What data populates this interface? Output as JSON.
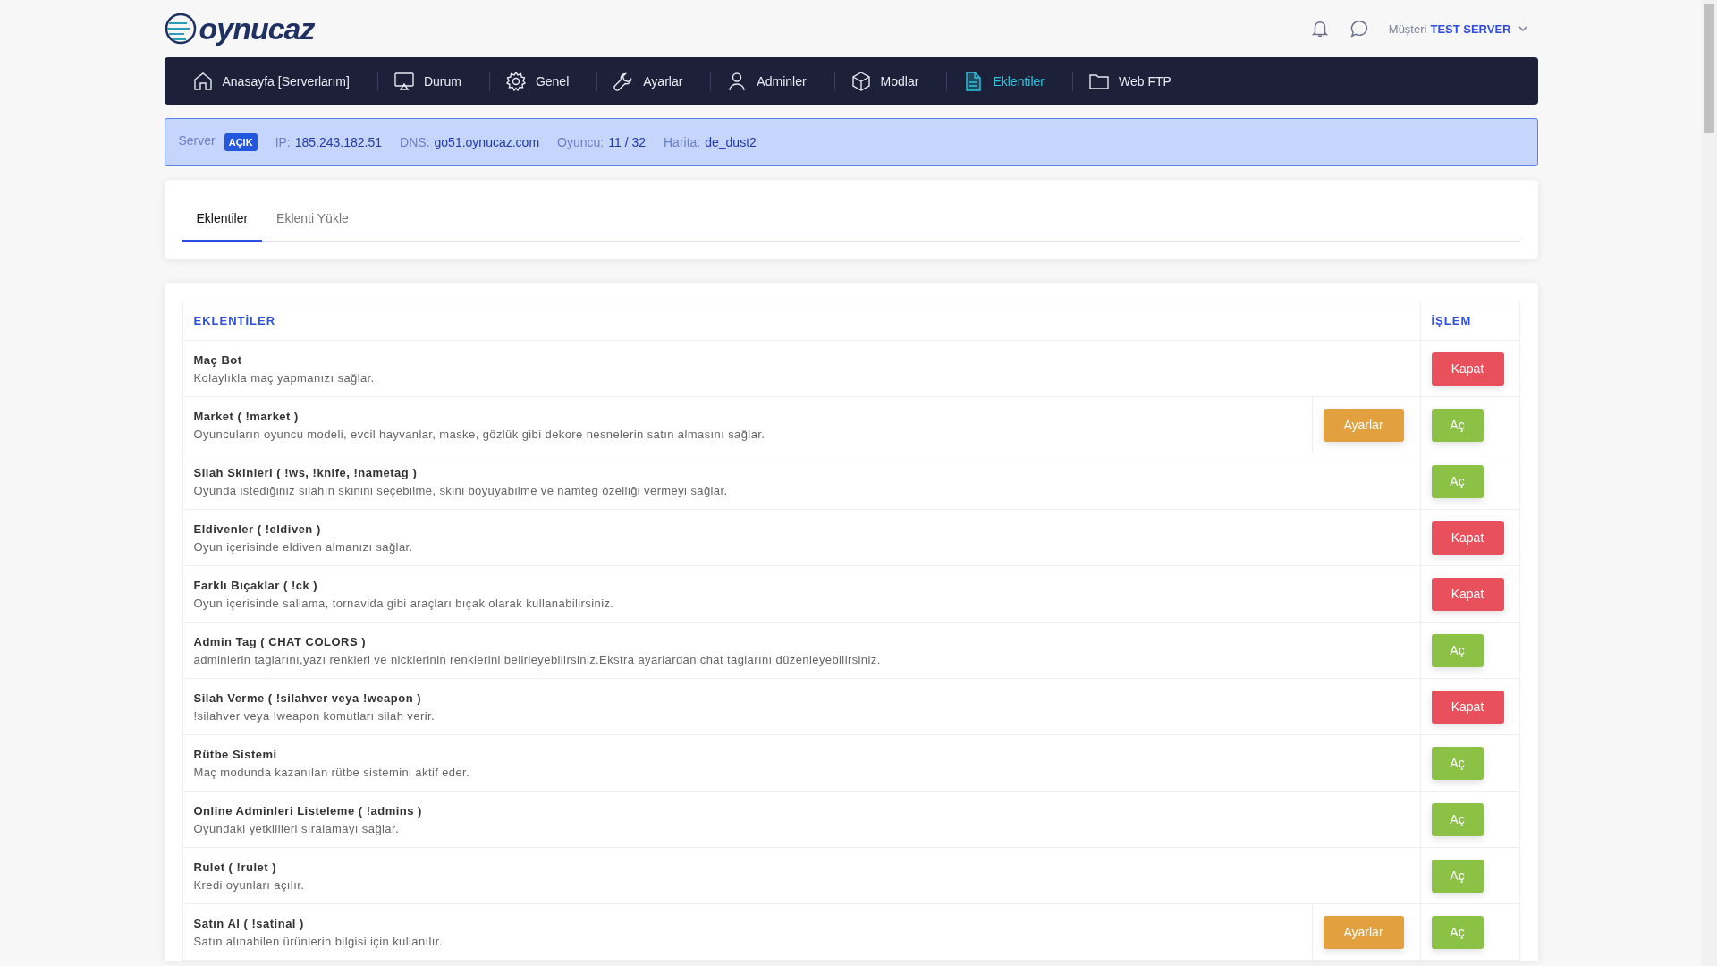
{
  "logo": {
    "text": "oynucaz"
  },
  "header": {
    "role": "Müşteri",
    "server": "TEST SERVER"
  },
  "nav": [
    {
      "label": "Anasayfa [Serverlarım]",
      "selected": false
    },
    {
      "label": "Durum",
      "selected": false
    },
    {
      "label": "Genel",
      "selected": false
    },
    {
      "label": "Ayarlar",
      "selected": false
    },
    {
      "label": "Adminler",
      "selected": false
    },
    {
      "label": "Modlar",
      "selected": false
    },
    {
      "label": "Eklentiler",
      "selected": true
    },
    {
      "label": "Web FTP",
      "selected": false
    }
  ],
  "server_info": {
    "server_label": "Server",
    "status": "AÇIK",
    "fields": [
      {
        "label": "IP:",
        "value": "185.243.182.51"
      },
      {
        "label": "DNS:",
        "value": "go51.oynucaz.com"
      },
      {
        "label": "Oyuncu:",
        "value": "11 / 32"
      },
      {
        "label": "Harita:",
        "value": "de_dust2"
      }
    ]
  },
  "tabs": [
    {
      "label": "Eklentiler",
      "selected": true
    },
    {
      "label": "Eklenti Yükle",
      "selected": false
    }
  ],
  "table": {
    "columns": [
      "EKLENTİLER",
      "İŞLEM"
    ],
    "rows": [
      {
        "name": "Maç Bot",
        "description": "Kolaylıkla maç yapmanızı sağlar.",
        "action": {
          "label": "Kapat",
          "kind": "close"
        }
      },
      {
        "name": "Market ( !market )",
        "description": "Oyuncuların oyuncu modeli, evcil hayvanlar, maske, gözlük gibi dekore nesnelerin satın almasını sağlar.",
        "settings": "Ayarlar",
        "action": {
          "label": "Aç",
          "kind": "open"
        }
      },
      {
        "name": "Silah Skinleri ( !ws, !knife, !nametag )",
        "description": "Oyunda istediğiniz silahın skinini seçebilme, skini boyuyabilme ve namteg özelliği vermeyi sağlar.",
        "action": {
          "label": "Aç",
          "kind": "open"
        }
      },
      {
        "name": "Eldivenler ( !eldiven )",
        "description": "Oyun içerisinde eldiven almanızı sağlar.",
        "action": {
          "label": "Kapat",
          "kind": "close"
        }
      },
      {
        "name": "Farklı Bıçaklar ( !ck )",
        "description": "Oyun içerisinde sallama, tornavida gibi araçları bıçak olarak kullanabilirsiniz.",
        "action": {
          "label": "Kapat",
          "kind": "close"
        }
      },
      {
        "name": "Admin Tag ( CHAT COLORS )",
        "description": "adminlerin taglarını,yazı renkleri ve nicklerinin renklerini belirleyebilirsiniz.Ekstra ayarlardan chat taglarını düzenleyebilirsiniz.",
        "action": {
          "label": "Aç",
          "kind": "open"
        }
      },
      {
        "name": "Silah Verme ( !silahver veya !weapon )",
        "description": "!silahver veya !weapon komutları silah verir.",
        "action": {
          "label": "Kapat",
          "kind": "close"
        }
      },
      {
        "name": "Rütbe Sistemi",
        "description": "Maç modunda kazanılan rütbe sistemini aktif eder.",
        "action": {
          "label": "Aç",
          "kind": "open"
        }
      },
      {
        "name": "Online Adminleri Listeleme ( !admins )",
        "description": "Oyundaki yetkilileri sıralamayı sağlar.",
        "action": {
          "label": "Aç",
          "kind": "open"
        }
      },
      {
        "name": "Rulet ( !rulet )",
        "description": "Kredi oyunları açılır.",
        "action": {
          "label": "Aç",
          "kind": "open"
        }
      },
      {
        "name": "Satın Al ( !satinal )",
        "description": "Satın alınabilen ürünlerin bilgisi için kullanılır.",
        "settings": "Ayarlar",
        "action": {
          "label": "Aç",
          "kind": "open"
        }
      }
    ]
  }
}
